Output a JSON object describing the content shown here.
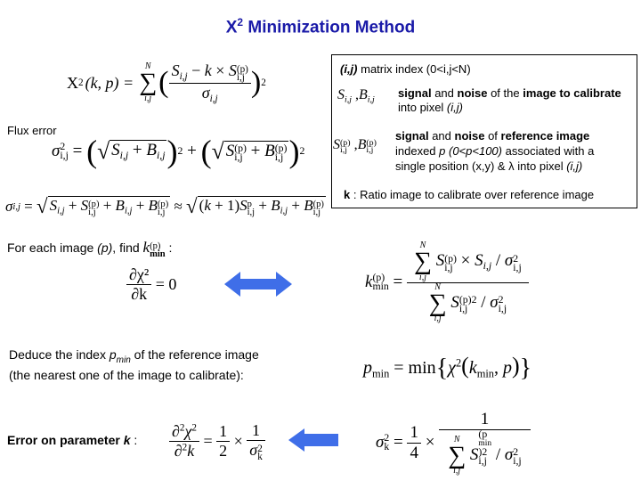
{
  "title": {
    "main": "X",
    "sup": "2",
    "rest": " Minimization Method"
  },
  "chi2_formula": {
    "lhs": "X",
    "lhs_sup": "2",
    "lhs_args": "(k, p) =",
    "sum_top": "N",
    "sum_bottom": "i,j",
    "numerator": "S_{i,j} − k × S^{(p)}_{i,j}",
    "denominator": "σ_{i,j}",
    "exponent": "2"
  },
  "legend_box": {
    "line1_bold": "(i,j)",
    "line1_text": " matrix index (0<i,j<N)",
    "symbol2": "S_{i,j} , B_{i,j}",
    "line2_b1": "signal",
    "line2_t1": " and ",
    "line2_b2": "noise",
    "line2_t2": " of the ",
    "line2_b3": "image to calibrate",
    "line2_t3": "into pixel ",
    "line2_t3_i": "(i,j)",
    "symbol3": "S^{(p)}_{i,j} , B^{(p)}_{i,j}",
    "line3_b1": "signal",
    "line3_t1": " and ",
    "line3_b2": "noise",
    "line3_t2": " of ",
    "line3_b3": "reference image",
    "line3_t3": "indexed ",
    "line3_t3_i": "p (0<p<100)",
    "line3_t4": " associated with a",
    "line3_t5": "single position (x,y) & λ into pixel ",
    "line3_t5_i": "(i,j)",
    "line4_bold": "k",
    "line4_text": " : Ratio image to calibrate over reference image"
  },
  "flux_error": {
    "label": "Flux error",
    "sigma2_formula": "σ²_{i,j} = (√(S_{i,j} + B_{i,j}))² + (√(S^{(p)}_{i,j} + B^{(p)}_{i,j}))²",
    "sigma_formula": "σ_{i,j} = √(S_{i,j} + S^{(p)}_{i,j} + B_{i,j} + B^{(p)}_{i,j}) ≈ √((k+1)S^p_{i,j} + B_{i,j} + B^{(p)}_{i,j})"
  },
  "kmin_section": {
    "text_a": "For each image ",
    "text_p": "(p)",
    "text_b": ", find ",
    "kmin_symbol": "k^{(p)}_{min}",
    "text_c": " :",
    "deriv_num": "∂χ²",
    "deriv_den": "∂k",
    "deriv_rhs": "= 0",
    "kmin_formula": "k^{(p)}_{min} = Σ^N_{i,j} S^{(p)}_{i,j} × S_{i,j} / σ²_{i,j} ÷ Σ^N_{i,j} S^{(p)2}_{i,j} / σ²_{i,j}"
  },
  "pmin_section": {
    "line1_a": "Deduce the index ",
    "line1_p": "p",
    "line1_sub": "min",
    "line1_b": " of the reference image",
    "line2": "(the nearest one of the image to calibrate):",
    "formula": "p_min = min{χ²(k_min, p)}"
  },
  "error_section": {
    "label_a": "Error on parameter ",
    "label_k": "k",
    "label_b": " :",
    "second_deriv": "∂²χ² / ∂²k = 1/2 × 1/σ²_k",
    "sigma_k_formula": "σ²_k = 1/4 × 1 / Σ^N_{i,j} S^{(p_min)2}_{i,j} / σ²_{i,j}"
  },
  "colors": {
    "title": "#1a1aa8",
    "arrow": "#3f6ee8"
  }
}
